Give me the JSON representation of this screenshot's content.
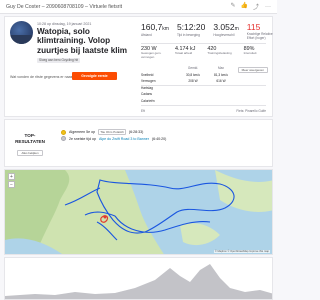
{
  "header": {
    "title": "Guy De Coster – 2090608708109 – Virtuele fietsrit",
    "icons": [
      "edit-icon",
      "thumbs-up-icon",
      "share-icon"
    ],
    "more": "···"
  },
  "activity": {
    "datetime": "10:28 op dinsdag, 19 januari 2021",
    "title": "Watopia, solo klimtraining. Volop zuurtjes bij laatste klim",
    "tag": "Sloeg aan bero Gcycling hit",
    "kudos_text": "Wat vonden de ritste gegevens er naast?",
    "kudos_button": "Gevolgde eerste inschrijving"
  },
  "stats": {
    "distance": {
      "value": "160,7",
      "unit": "km",
      "label": "Afstand"
    },
    "time": {
      "value": "5:12:20",
      "label": "Tijd in beweging"
    },
    "elevation": {
      "value": "3.052",
      "unit": "m",
      "label": "Hoogteverschil"
    },
    "relative_effort": {
      "value": "115",
      "label": "Krachtige Relative Effort (hoger)"
    },
    "power": {
      "value": "230",
      "unit": "W",
      "label": "Gewogen gem. vermogen"
    },
    "energy": {
      "value": "4.174",
      "unit": "kJ",
      "label": "Totaal arbeid"
    },
    "training_load": {
      "value": "420",
      "label": "Trainingsbelasting"
    },
    "intensity": {
      "value": "89",
      "unit": "%",
      "label": "Intensiteit"
    }
  },
  "table": {
    "headers": [
      "",
      "Gemid.",
      "Max"
    ],
    "rows": [
      [
        "Snelheid",
        "30,8 km/u",
        "81,3 km/u"
      ],
      [
        "Vermogen",
        "208 W",
        "616 W"
      ],
      [
        "Hartslag",
        "",
        ""
      ],
      [
        "Cadans",
        "",
        ""
      ],
      [
        "Calorieën",
        "",
        ""
      ]
    ],
    "more_button": "Meer weergeven"
  },
  "device": {
    "left": "Eft",
    "right": "Fiets: Pinarello Gulfe"
  },
  "results": {
    "heading": "TOP-RESULTATEN",
    "show_button": "Alles bekijken",
    "achievements": [
      {
        "pre": "Algemeen 5e op",
        "link": "Tite Obm Polaitch",
        "post": "(6:28:33)"
      },
      {
        "pre": "2e snelste tijd op",
        "link": "Alpe du Zwift Road 3 to Banner",
        "post": "(6:40:20)"
      }
    ]
  },
  "map": {
    "attribution": "© Mapbox © OpenStreetMap Improve this map",
    "zoom_in": "+",
    "zoom_out": "−"
  }
}
